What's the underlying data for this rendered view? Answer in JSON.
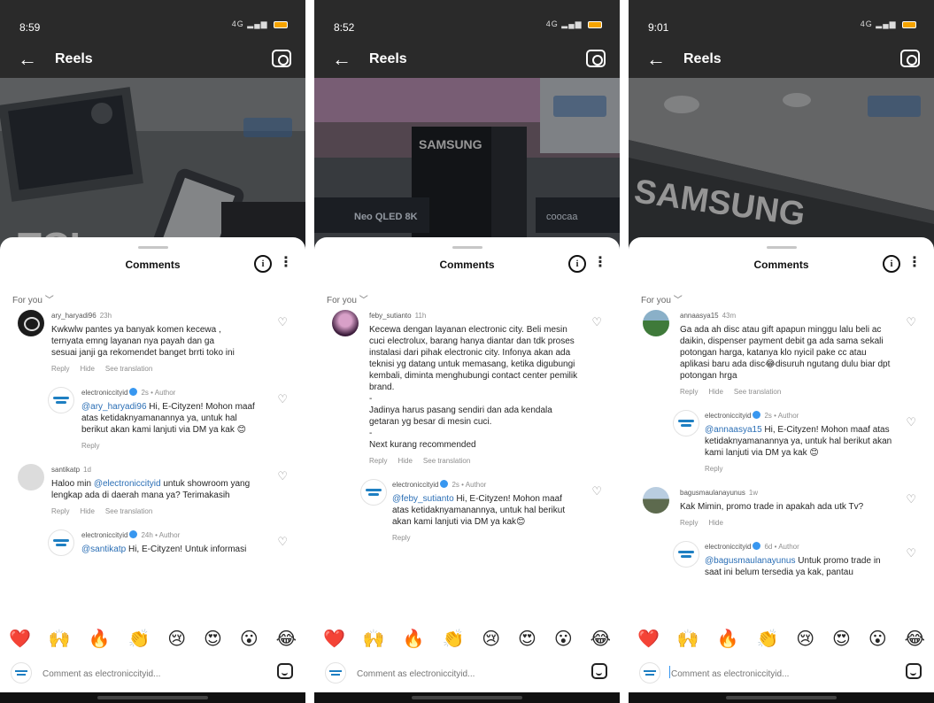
{
  "colors": {
    "accent": "#3897f0",
    "mention": "#2a6eb5",
    "header_bg": "#000000",
    "sheet_bg": "#ffffff"
  },
  "icons": [
    "back-arrow-icon",
    "camera-icon",
    "info-icon",
    "more-options-icon",
    "heart-outline-icon",
    "verified-badge-icon",
    "sticker-icon"
  ],
  "panels": [
    {
      "status": {
        "time": "8:59",
        "signal": "4G"
      },
      "header": {
        "title": "Reels"
      },
      "sheet": {
        "title": "Comments",
        "filter": "For you"
      },
      "comments": [
        {
          "username": "ary_haryadi96",
          "time": "23h",
          "text": "Kwkwlw pantes ya banyak komen kecewa ,\nternyata emng layanan nya payah  dan ga\nsesuai janji ga rekomendet banget brrti toko ini",
          "actions": {
            "reply": "Reply",
            "hide": "Hide",
            "translate": "See translation"
          }
        },
        {
          "username": "electroniccityid",
          "time": "2s",
          "author": "Author",
          "mention": "@ary_haryadi96",
          "text": " Hi, E-Cityzen! Mohon maaf atas ketidaknyamanannya ya, untuk hal berikut akan kami lanjuti via DM ya kak 😊",
          "actions": {
            "reply": "Reply"
          }
        },
        {
          "username": "santikatp",
          "time": "1d",
          "pre": "Haloo min ",
          "mention": "@electroniccityid",
          "text": " untuk showroom yang lengkap ada di daerah mana ya? Terimakasih",
          "actions": {
            "reply": "Reply",
            "hide": "Hide",
            "translate": "See translation"
          }
        },
        {
          "username": "electroniccityid",
          "time": "24h",
          "author": "Author",
          "mention": "@santikatp",
          "text": " Hi, E-Cityzen! Untuk informasi",
          "actions": {
            "reply": ""
          }
        }
      ],
      "compose": {
        "placeholder": "Comment as electroniccityid..."
      }
    },
    {
      "status": {
        "time": "8:52",
        "signal": "4G"
      },
      "header": {
        "title": "Reels"
      },
      "sheet": {
        "title": "Comments",
        "filter": "For you"
      },
      "comments": [
        {
          "username": "feby_sutianto",
          "time": "11h",
          "text": "Kecewa dengan layanan electronic city. Beli mesin cuci electrolux, barang hanya diantar dan tdk proses instalasi dari pihak electronic city. Infonya akan ada teknisi yg datang untuk memasang, ketika digubungi kembali, diminta menghubungi contact center pemilik brand.\n-\nJadinya harus pasang sendiri dan ada kendala getaran yg besar di mesin cuci.\n-\nNext kurang recommended",
          "actions": {
            "reply": "Reply",
            "hide": "Hide",
            "translate": "See translation"
          }
        },
        {
          "username": "electroniccityid",
          "time": "2s",
          "author": "Author",
          "mention": "@feby_sutianto",
          "text": " Hi, E-Cityzen! Mohon maaf atas ketidaknyamanannya, untuk hal berikut akan kami lanjuti via DM ya kak😊",
          "actions": {
            "reply": "Reply"
          }
        }
      ],
      "compose": {
        "placeholder": "Comment as electroniccityid..."
      }
    },
    {
      "status": {
        "time": "9:01",
        "signal": "4G"
      },
      "header": {
        "title": "Reels"
      },
      "sheet": {
        "title": "Comments",
        "filter": "For you"
      },
      "comments": [
        {
          "username": "annaasya15",
          "time": "43m",
          "text": "Ga ada ah disc atau gift apapun minggu lalu beli ac daikin, dispenser payment debit ga ada sama sekali potongan harga,  katanya klo nyicil pake cc atau aplikasi baru ada disc😂disuruh ngutang dulu biar dpt potongan hrga",
          "actions": {
            "reply": "Reply",
            "hide": "Hide",
            "translate": "See translation"
          }
        },
        {
          "username": "electroniccityid",
          "time": "2s",
          "author": "Author",
          "mention": "@annaasya15",
          "text": " Hi, E-Cityzen! Mohon maaf atas ketidaknyamanannya ya, untuk hal berikut akan kami lanjuti via DM ya kak 😊",
          "actions": {
            "reply": "Reply"
          }
        },
        {
          "username": "bagusmaulanayunus",
          "time": "1w",
          "text": "Kak Mimin, promo trade in apakah ada utk Tv?",
          "actions": {
            "reply": "Reply",
            "hide": "Hide"
          }
        },
        {
          "username": "electroniccityid",
          "time": "6d",
          "author": "Author",
          "mention": "@bagusmaulanayunus",
          "text": " Untuk promo trade in saat ini belum tersedia ya kak, pantau",
          "actions": {
            "reply": ""
          }
        }
      ],
      "compose": {
        "placeholder": "Comment as electroniccityid..."
      }
    }
  ],
  "photos": [
    {
      "label": "TCL"
    },
    {
      "label": "SAMSUNG",
      "sublabel": "Neo QLED 8K",
      "sublabel2": "coocaa"
    },
    {
      "label": "SAMSUNG"
    }
  ],
  "emojis": [
    "❤️",
    "🙌",
    "🔥",
    "👏",
    "😢",
    "😍",
    "😮",
    "😂"
  ]
}
